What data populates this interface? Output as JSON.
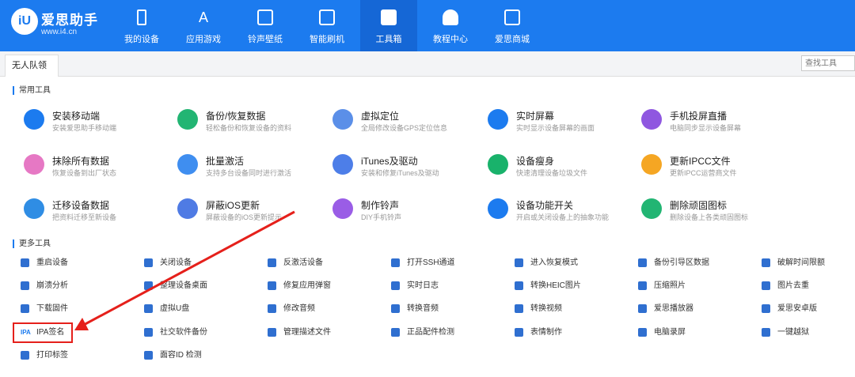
{
  "app": {
    "brand": "爱思助手",
    "url": "www.i4.cn",
    "logo": "iU"
  },
  "nav": [
    {
      "label": "我的设备",
      "icon": "phone-icon"
    },
    {
      "label": "应用游戏",
      "icon": "app-store-icon"
    },
    {
      "label": "铃声壁纸",
      "icon": "music-icon"
    },
    {
      "label": "智能刷机",
      "icon": "refresh-icon"
    },
    {
      "label": "工具箱",
      "icon": "toolbox-icon",
      "active": true
    },
    {
      "label": "教程中心",
      "icon": "graduation-cap-icon"
    },
    {
      "label": "爱思商城",
      "icon": "store-icon"
    }
  ],
  "tab": {
    "label": "无人队领"
  },
  "search": {
    "placeholder": "查找工具"
  },
  "sections": {
    "common": "常用工具",
    "more": "更多工具"
  },
  "common_tools": [
    {
      "name": "安装移动端",
      "desc": "安装爱思助手移动端",
      "color": "#1c7bef"
    },
    {
      "name": "备份/恢复数据",
      "desc": "轻松备份和恢复设备的资料",
      "color": "#22b573"
    },
    {
      "name": "虚拟定位",
      "desc": "全局修改设备GPS定位信息",
      "color": "#5b8fe8"
    },
    {
      "name": "实时屏幕",
      "desc": "实时显示设备屏幕的画面",
      "color": "#1c7bef"
    },
    {
      "name": "手机投屏直播",
      "desc": "电脑同步显示设备屏幕",
      "color": "#8f57e0"
    },
    {
      "name": "抹除所有数据",
      "desc": "恢复设备到出厂状态",
      "color": "#e678c4"
    },
    {
      "name": "批量激活",
      "desc": "支持多台设备同时进行激活",
      "color": "#3f8ef0"
    },
    {
      "name": "iTunes及驱动",
      "desc": "安装和修复iTunes及驱动",
      "color": "#4d7ee8"
    },
    {
      "name": "设备瘦身",
      "desc": "快速清理设备垃圾文件",
      "color": "#19b26b"
    },
    {
      "name": "更新IPCC文件",
      "desc": "更新IPCC运营商文件",
      "color": "#f5a623"
    },
    {
      "name": "迁移设备数据",
      "desc": "把资料迁移至新设备",
      "color": "#2f8de4"
    },
    {
      "name": "屏蔽iOS更新",
      "desc": "屏蔽设备的iOS更新提示",
      "color": "#4f7be4"
    },
    {
      "name": "制作铃声",
      "desc": "DIY手机铃声",
      "color": "#9a5de6"
    },
    {
      "name": "设备功能开关",
      "desc": "开启或关闭设备上的抽象功能",
      "color": "#1c7bef"
    },
    {
      "name": "删除顽固图标",
      "desc": "删除设备上各类顽固图标",
      "color": "#22b573"
    }
  ],
  "more_tools": [
    [
      "重启设备",
      "关闭设备",
      "反激活设备",
      "打开SSH通道",
      "进入恢复模式",
      "备份引导区数据",
      "破解时间限额"
    ],
    [
      "崩溃分析",
      "整理设备桌面",
      "修复应用弹窗",
      "实时日志",
      "转换HEIC图片",
      "压缩照片",
      "图片去重"
    ],
    [
      "下载固件",
      "虚拟U盘",
      "修改音频",
      "转换音频",
      "转换视频",
      "爱思播放器",
      "爱思安卓版"
    ],
    [
      "IPA签名",
      "社交软件备份",
      "管理描述文件",
      "正品配件检测",
      "表情制作",
      "电脑录屏",
      "一键越狱"
    ],
    [
      "打印标签",
      "面容ID 检测"
    ]
  ],
  "ipa_icon_text": "IPA",
  "accent": "#1c7bef",
  "highlight": "#e5201b"
}
